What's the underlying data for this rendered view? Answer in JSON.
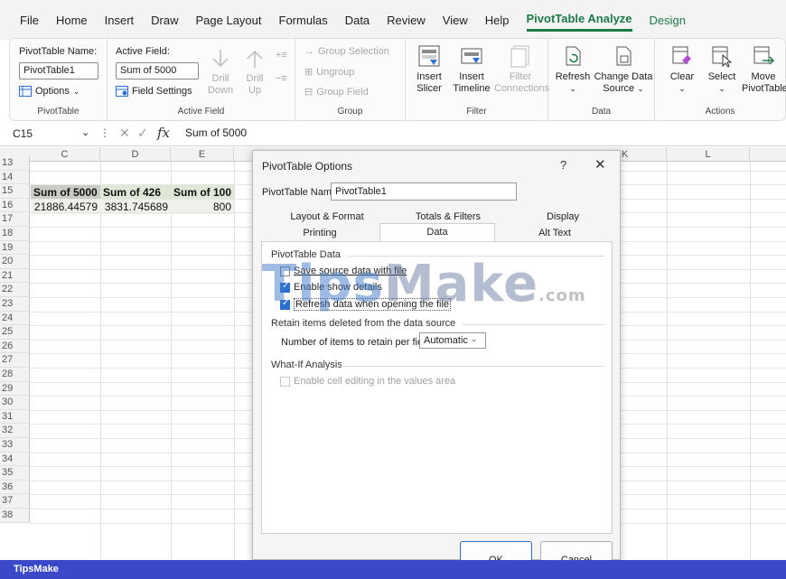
{
  "ribbon_tabs": [
    "File",
    "Home",
    "Insert",
    "Draw",
    "Page Layout",
    "Formulas",
    "Data",
    "Review",
    "View",
    "Help",
    "PivotTable Analyze",
    "Design"
  ],
  "ribbon": {
    "pivottable": {
      "name_label": "PivotTable Name:",
      "name_value": "PivotTable1",
      "options": "Options",
      "group": "PivotTable"
    },
    "active_field": {
      "label": "Active Field:",
      "value": "Sum of 5000",
      "field_settings": "Field Settings",
      "drill_down_1": "Drill",
      "drill_down_2": "Down",
      "drill_up_1": "Drill",
      "drill_up_2": "Up",
      "group": "Active Field"
    },
    "group": {
      "group_selection": "Group Selection",
      "ungroup": "Ungroup",
      "group_field": "Group Field",
      "group": "Group"
    },
    "filter": {
      "insert_slicer_1": "Insert",
      "insert_slicer_2": "Slicer",
      "insert_timeline_1": "Insert",
      "insert_timeline_2": "Timeline",
      "filter_conn_1": "Filter",
      "filter_conn_2": "Connections",
      "group": "Filter"
    },
    "data": {
      "refresh": "Refresh",
      "change_source_1": "Change Data",
      "change_source_2": "Source",
      "group": "Data"
    },
    "actions": {
      "clear": "Clear",
      "select": "Select",
      "move_1": "Move",
      "move_2": "PivotTable",
      "group": "Actions"
    }
  },
  "formula_bar": {
    "name_box": "C15",
    "content": "Sum of 5000",
    "fx": "fx"
  },
  "grid": {
    "columns": [
      "C",
      "D",
      "E",
      "K",
      "L"
    ],
    "rows": [
      "13",
      "14",
      "15",
      "16",
      "17",
      "18",
      "19",
      "20",
      "21",
      "22",
      "23",
      "24",
      "25",
      "26",
      "27",
      "28",
      "29",
      "30",
      "31",
      "32",
      "33",
      "34",
      "35",
      "36",
      "37",
      "38"
    ],
    "headers": [
      "Sum of 5000",
      "Sum of 426",
      "Sum of 100"
    ],
    "values": [
      "21886.44579",
      "3831.745689",
      "800"
    ]
  },
  "dialog": {
    "title": "PivotTable Options",
    "help": "?",
    "close": "✕",
    "name_label": "PivotTable Name:",
    "name_value": "PivotTable1",
    "tabs_row1": [
      "Layout & Format",
      "Totals & Filters",
      "Display"
    ],
    "tabs_row2": [
      "Printing",
      "Data",
      "Alt Text"
    ],
    "section_data": "PivotTable Data",
    "save_source": "Save source data with file",
    "enable_details": "Enable show details",
    "refresh_open": "Refresh data when opening the file",
    "section_retain": "Retain items deleted from the data source",
    "retain_label": "Number of items to retain per field:",
    "retain_value": "Automatic",
    "section_whatif": "What-If Analysis",
    "enable_editing": "Enable cell editing in the values area",
    "ok": "OK",
    "cancel": "Cancel"
  },
  "watermark": {
    "tips": "Tips",
    "make": "Make",
    "dotcom": ".com"
  },
  "footer": "TipsMake"
}
